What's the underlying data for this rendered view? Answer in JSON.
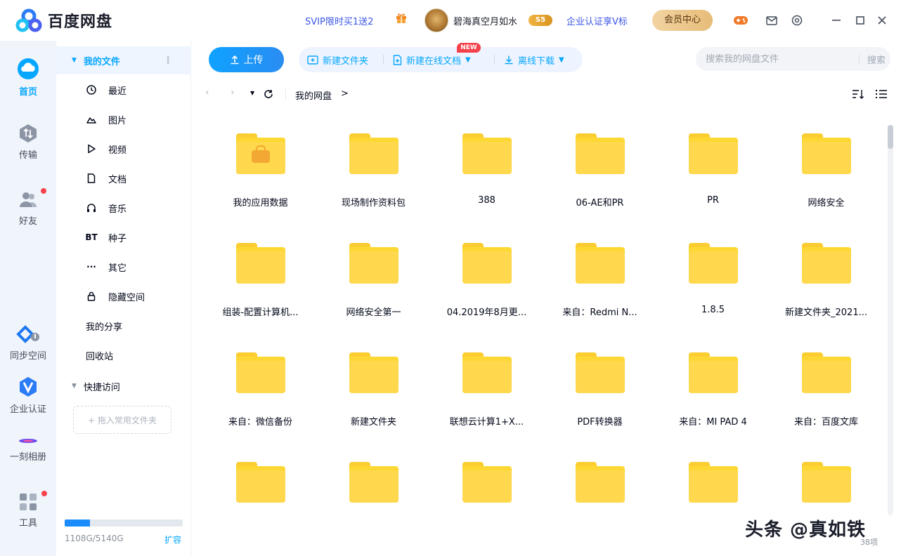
{
  "app": {
    "name": "百度网盘"
  },
  "header": {
    "svip_promo": "SVIP限时买1送2",
    "username": "碧海真空月如水",
    "level_badge": "5",
    "enterprise_promo": "企业认证享V标",
    "vip_center": "会员中心"
  },
  "rail": [
    {
      "label": "首页",
      "icon": "home-cloud-icon",
      "active": true
    },
    {
      "label": "传输",
      "icon": "transfer-icon",
      "active": false
    },
    {
      "label": "好友",
      "icon": "friends-icon",
      "active": false,
      "dot": true
    },
    {
      "label": "同步空间",
      "icon": "sync-icon",
      "active": false
    },
    {
      "label": "企业认证",
      "icon": "enterprise-v-icon",
      "active": false
    },
    {
      "label": "一刻相册",
      "icon": "album-icon",
      "active": false
    },
    {
      "label": "工具",
      "icon": "tools-icon",
      "active": false,
      "dot": true
    }
  ],
  "sidebar": {
    "my_files": "我的文件",
    "items": [
      {
        "label": "最近",
        "icon": "clock-icon"
      },
      {
        "label": "图片",
        "icon": "image-icon"
      },
      {
        "label": "视频",
        "icon": "video-icon"
      },
      {
        "label": "文档",
        "icon": "document-icon"
      },
      {
        "label": "音乐",
        "icon": "headphones-icon"
      },
      {
        "label": "种子",
        "icon": "bt-icon",
        "glyph": "BT"
      },
      {
        "label": "其它",
        "icon": "more-icon",
        "glyph": "···"
      },
      {
        "label": "隐藏空间",
        "icon": "lock-icon"
      }
    ],
    "my_share": "我的分享",
    "recycle": "回收站",
    "quick_access": "快捷访问",
    "drop_hint": "+ 拖入常用文件夹",
    "quota_text": "1108G/5140G",
    "quota_fraction": 0.216,
    "expand": "扩容"
  },
  "toolbar": {
    "upload": "上传",
    "new_folder": "新建文件夹",
    "new_online_doc": "新建在线文档",
    "new_tag": "NEW",
    "offline_download": "离线下载",
    "search_placeholder": "搜索我的网盘文件",
    "search_button": "搜索"
  },
  "breadcrumb": {
    "root": "我的网盘",
    "sep": ">"
  },
  "folders": [
    {
      "name": "我的应用数据",
      "special": true
    },
    {
      "name": "现场制作资料包"
    },
    {
      "name": "388"
    },
    {
      "name": "06-AE和PR"
    },
    {
      "name": "PR"
    },
    {
      "name": "网络安全"
    },
    {
      "name": "组装-配置计算机..."
    },
    {
      "name": "网络安全第一"
    },
    {
      "name": "04.2019年8月更..."
    },
    {
      "name": "来自：Redmi N..."
    },
    {
      "name": "1.8.5"
    },
    {
      "name": "新建文件夹_2021..."
    },
    {
      "name": "来自：微信备份"
    },
    {
      "name": "新建文件夹"
    },
    {
      "name": "联想云计算1+X..."
    },
    {
      "name": "PDF转换器"
    },
    {
      "name": "来自：MI PAD 4"
    },
    {
      "name": "来自：百度文库"
    },
    {
      "name": ""
    },
    {
      "name": ""
    },
    {
      "name": ""
    },
    {
      "name": ""
    },
    {
      "name": ""
    },
    {
      "name": ""
    }
  ],
  "footer": {
    "count": "38项"
  },
  "watermark": "头条 @真如铁",
  "colors": {
    "accent": "#06a7ff",
    "folder": "#ffd84d",
    "upload": "#1b8dfb"
  }
}
